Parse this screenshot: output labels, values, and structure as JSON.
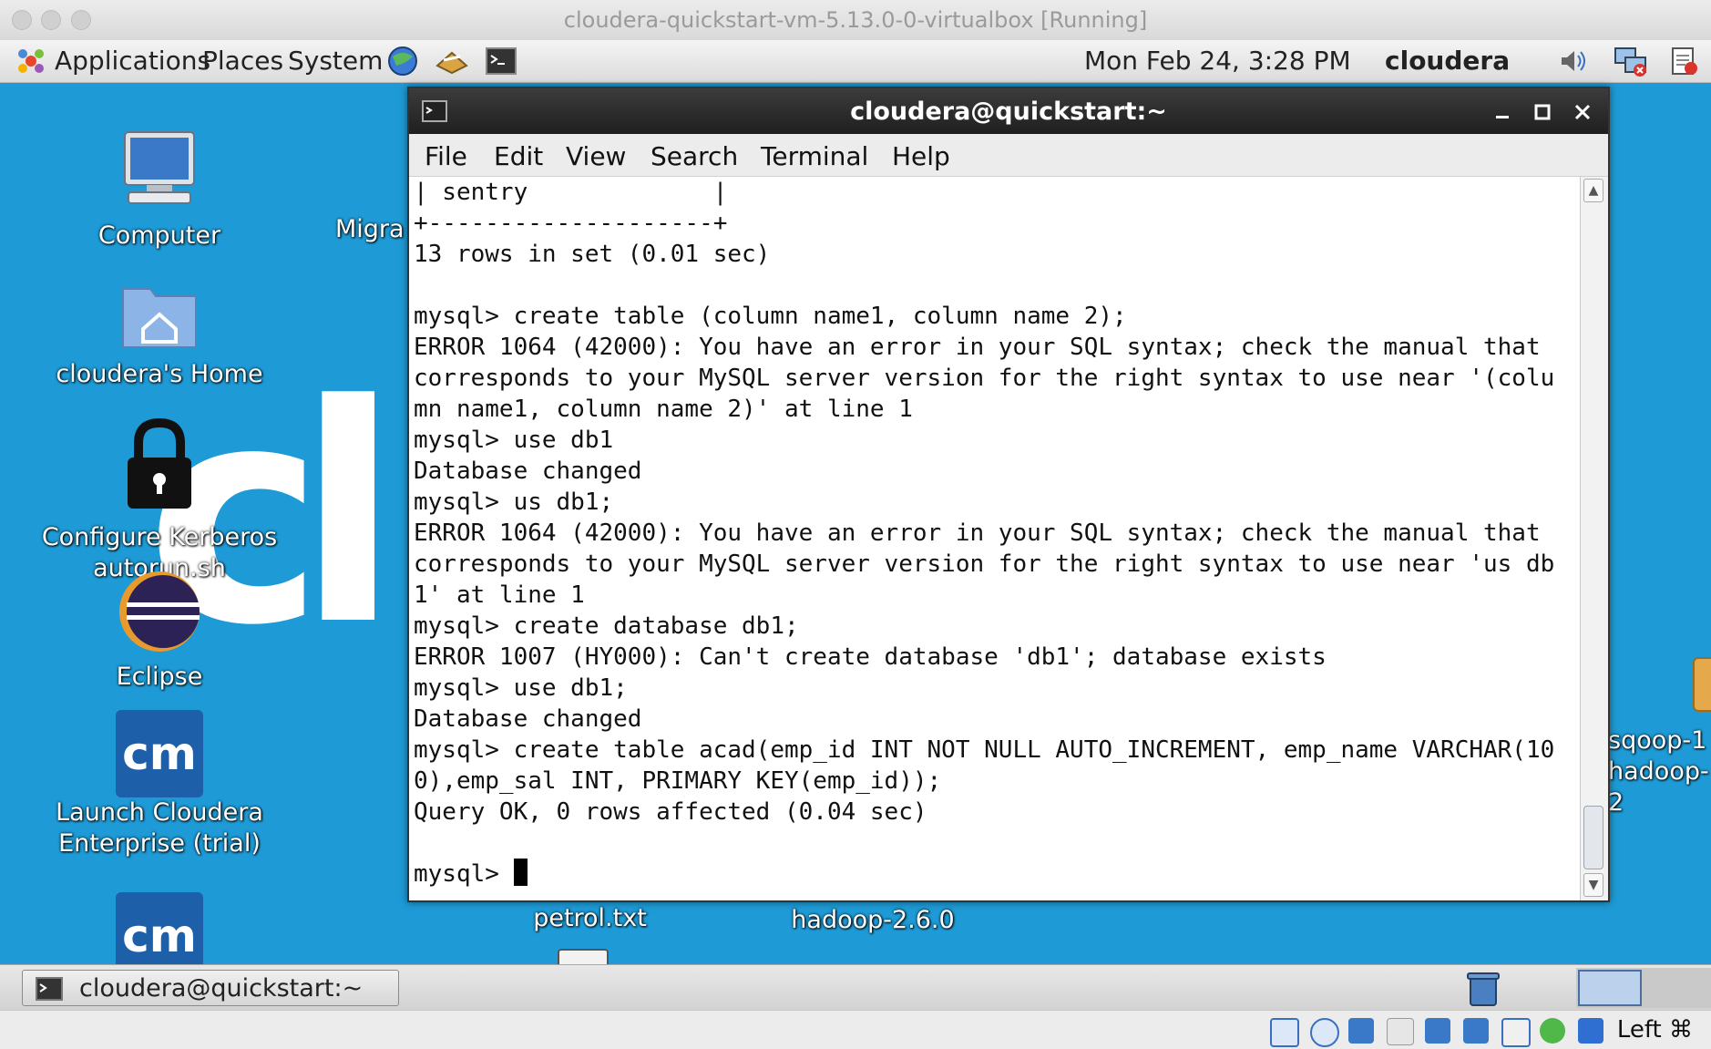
{
  "host_window": {
    "title": "cloudera-quickstart-vm-5.13.0-0-virtualbox [Running]"
  },
  "top_panel": {
    "menus": [
      "Applications",
      "Places",
      "System"
    ],
    "clock": "Mon Feb 24,  3:28 PM",
    "user": "cloudera"
  },
  "desktop": {
    "icons": {
      "computer": "Computer",
      "home": "cloudera's Home",
      "kerberos": [
        "Configure Kerberos",
        "autorun.sh"
      ],
      "eclipse": "Eclipse",
      "cloudera_launch": [
        "Launch Cloudera",
        "Enterprise (trial)"
      ],
      "migrate_partial": "Migra",
      "petrol": "petrol.txt",
      "hadoop": "hadoop-2.6.0",
      "sqoop_right": [
        "sqoop-1",
        "hadoop-2"
      ],
      "cm_text": "cm"
    }
  },
  "terminal": {
    "title": "cloudera@quickstart:~",
    "menus": [
      "File",
      "Edit",
      "View",
      "Search",
      "Terminal",
      "Help"
    ],
    "lines": [
      "| sentry             |",
      "+--------------------+",
      "13 rows in set (0.01 sec)",
      "",
      "mysql> create table (column name1, column name 2);",
      "ERROR 1064 (42000): You have an error in your SQL syntax; check the manual that",
      "corresponds to your MySQL server version for the right syntax to use near '(colu",
      "mn name1, column name 2)' at line 1",
      "mysql> use db1",
      "Database changed",
      "mysql> us db1;",
      "ERROR 1064 (42000): You have an error in your SQL syntax; check the manual that",
      "corresponds to your MySQL server version for the right syntax to use near 'us db",
      "1' at line 1",
      "mysql> create database db1;",
      "ERROR 1007 (HY000): Can't create database 'db1'; database exists",
      "mysql> use db1;",
      "Database changed",
      "mysql> create table acad(emp_id INT NOT NULL AUTO_INCREMENT, emp_name VARCHAR(10",
      "0),emp_sal INT, PRIMARY KEY(emp_id));",
      "Query OK, 0 rows affected (0.04 sec)",
      "",
      "mysql> "
    ]
  },
  "bottom_panel": {
    "task": "cloudera@quickstart:~"
  },
  "vbox_status": {
    "host_key": "Left ⌘"
  }
}
